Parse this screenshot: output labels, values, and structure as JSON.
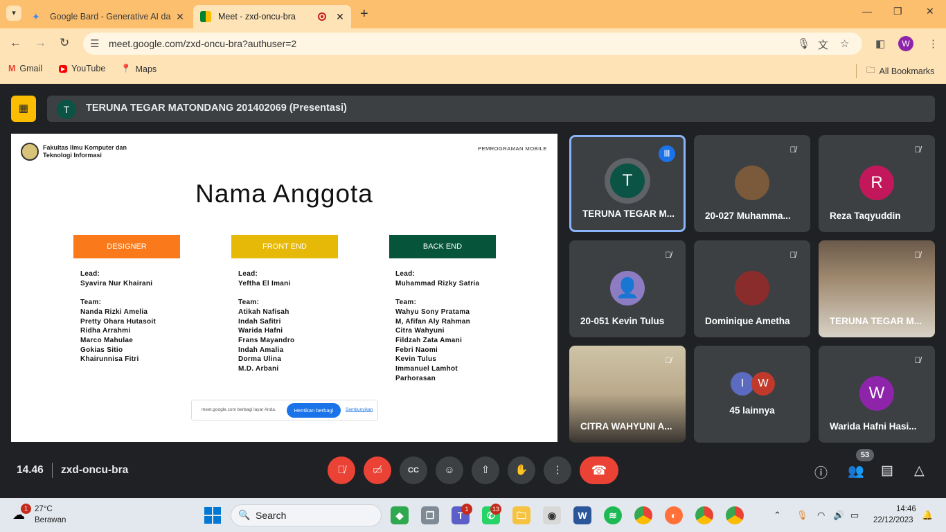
{
  "browser": {
    "tabs": [
      {
        "title": "Google Bard - Generative AI da",
        "active": false
      },
      {
        "title": "Meet - zxd-oncu-bra",
        "active": true
      }
    ],
    "url": "meet.google.com/zxd-oncu-bra?authuser=2",
    "profile_initial": "W",
    "bookmarks": [
      "Gmail",
      "YouTube",
      "Maps"
    ],
    "all_bookmarks": "All Bookmarks"
  },
  "meet": {
    "presenter_initial": "T",
    "presenter_label": "TERUNA TEGAR MATONDANG 201402069 (Presentasi)",
    "time": "14.46",
    "meeting_code": "zxd-oncu-bra",
    "people_count": "53"
  },
  "slide": {
    "faculty": "Fakultas Ilmu Komputer dan Teknologi Informasi",
    "course": "PEMROGRAMAN MOBILE",
    "title": "Nama Anggota",
    "roles": [
      {
        "label": "DESIGNER",
        "color": "#fa7a1b"
      },
      {
        "label": "FRONT END",
        "color": "#e6b908"
      },
      {
        "label": "BACK END",
        "color": "#06553a"
      }
    ],
    "designer": [
      "Lead:",
      "Syavira Nur Khairani",
      "",
      "Team:",
      "Nanda Rizki Amelia",
      "Pretty Ohara Hutasoit",
      "Ridha Arrahmi",
      "Marco Mahulae",
      "Gokias Sitio",
      "Khairunnisa Fitri"
    ],
    "frontend": [
      "Lead:",
      "Yeftha El Imani",
      "",
      "Team:",
      "Atikah Nafisah",
      "Indah Safitri",
      "Warida Hafni",
      "Frans Mayandro",
      "Indah Amalia",
      "Dorma Ulina",
      "M.D. Arbani"
    ],
    "backend": [
      "Lead:",
      "Muhammad Rizky Satria",
      "",
      "Team:",
      "Wahyu Sony Pratama",
      "M, Afifan Aly Rahman",
      "Citra Wahyuni",
      "Fildzah Zata Amani",
      "Febri Naomi",
      "Kevin Tulus",
      "Immanuel Lamhot",
      "Parhorasan"
    ],
    "share_notice": "meet.google.com berbagi layar Anda.",
    "stop_sharing": "Hentikan berbagi",
    "hide": "Sembunyikan"
  },
  "participants": [
    {
      "name": "TERUNA TEGAR M...",
      "initial": "T",
      "color": "#0b5345",
      "speaking": true
    },
    {
      "name": "20-027 Muhamma...",
      "initial": "",
      "color": "#7a5a3a",
      "photo": true
    },
    {
      "name": "Reza Taqyuddin",
      "initial": "R",
      "color": "#c2185b"
    },
    {
      "name": "20-051 Kevin Tulus",
      "initial": "",
      "color": "#8e7cc3",
      "generic": true
    },
    {
      "name": "Dominique Ametha",
      "initial": "",
      "color": "#8b2c2c",
      "photo": true
    },
    {
      "name": "TERUNA TEGAR M...",
      "initial": "",
      "video": true
    },
    {
      "name": "CITRA WAHYUNI A...",
      "initial": "",
      "video": true
    },
    {
      "name": "45 lainnya",
      "initials": [
        "I",
        "W"
      ]
    },
    {
      "name": "Warida Hafni Hasi...",
      "initial": "W",
      "color": "#8e24aa"
    }
  ],
  "taskbar": {
    "temperature": "27°C",
    "condition": "Berawan",
    "weather_badge": "1",
    "search": "Search",
    "time": "14:46",
    "date": "22/12/2023",
    "teams_badge": "1",
    "whatsapp_badge": "13"
  }
}
